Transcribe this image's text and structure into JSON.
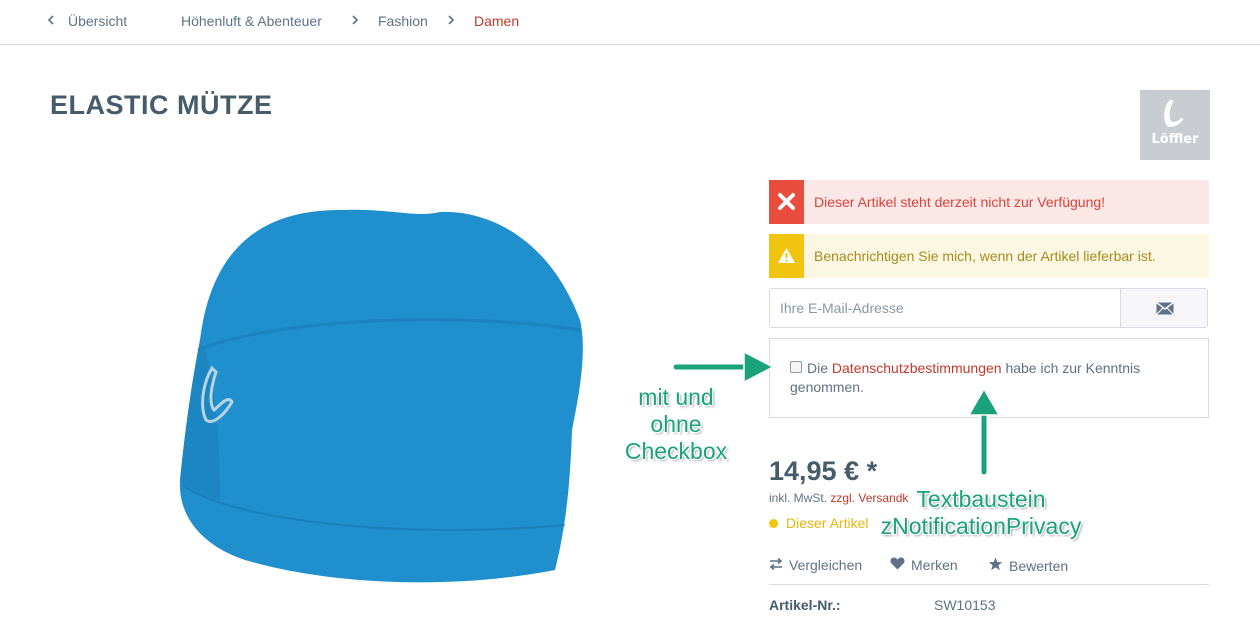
{
  "breadcrumb": {
    "back_label": "Übersicht",
    "items": [
      "Höhenluft & Abenteuer",
      "Fashion",
      "Damen"
    ]
  },
  "product": {
    "title": "ELASTIC MÜTZE",
    "brand": "Löffler",
    "image_icon": "beanie-product-image"
  },
  "alerts": {
    "error": "Dieser Artikel steht derzeit nicht zur Verfügung!",
    "warning": "Benachrichtigen Sie mich, wenn der Artikel lieferbar ist."
  },
  "notify": {
    "email_placeholder": "Ihre E-Mail-Adresse",
    "privacy_prefix": "Die ",
    "privacy_link": "Datenschutzbestimmungen",
    "privacy_suffix": " habe ich zur Kenntnis genommen."
  },
  "price": {
    "value": "14,95 € *",
    "tax_prefix": "inkl. MwSt. ",
    "tax_link": "zzgl. Versandk",
    "delivery": "Dieser Artikel"
  },
  "actions": {
    "compare": "Vergleichen",
    "remember": "Merken",
    "rate": "Bewerten"
  },
  "details": {
    "article_label": "Artikel-Nr.:",
    "article_value": "SW10153"
  },
  "annotations": {
    "left": [
      "mit und",
      "ohne",
      "Checkbox"
    ],
    "right": [
      "Textbaustein",
      "zNotificationPrivacy"
    ]
  },
  "colors": {
    "accent_red": "#c0392b",
    "error_red": "#e74c3c",
    "warning_yellow": "#f1c40f",
    "annotation_green": "#1aa37a",
    "product_blue": "#1f8fcd"
  }
}
